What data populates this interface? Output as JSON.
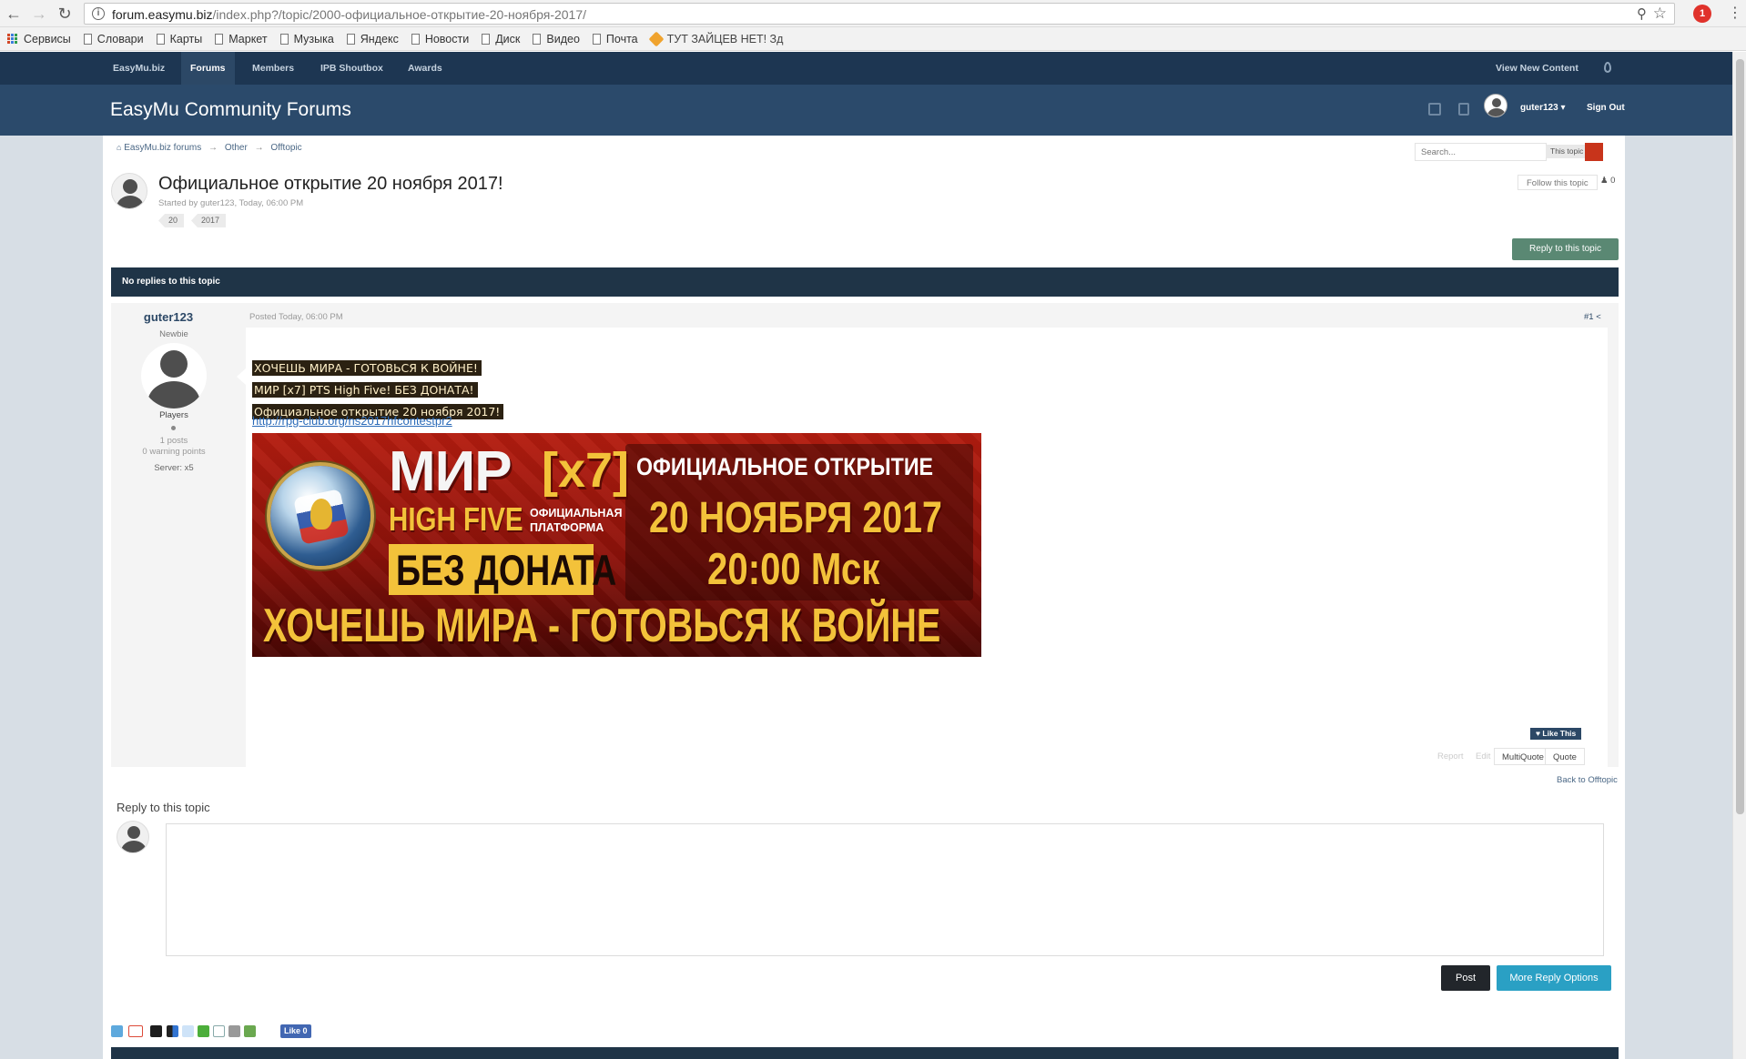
{
  "browser": {
    "url_domain": "forum.easymu.biz",
    "url_path": "/index.php?/topic/2000-официальное-открытие-20-ноября-2017/",
    "ext_badge": "1",
    "bookmarks": [
      {
        "label": "Сервисы",
        "icon": "apps-icon"
      },
      {
        "label": "Словари",
        "icon": "page-icon"
      },
      {
        "label": "Карты",
        "icon": "page-icon"
      },
      {
        "label": "Маркет",
        "icon": "page-icon"
      },
      {
        "label": "Музыка",
        "icon": "page-icon"
      },
      {
        "label": "Яндекс",
        "icon": "page-icon"
      },
      {
        "label": "Новости",
        "icon": "page-icon"
      },
      {
        "label": "Диск",
        "icon": "page-icon"
      },
      {
        "label": "Видео",
        "icon": "page-icon"
      },
      {
        "label": "Почта",
        "icon": "page-icon"
      },
      {
        "label": "ТУТ ЗАЙЦЕВ НЕТ! Зд",
        "icon": "tag-icon"
      }
    ]
  },
  "nav": {
    "items": [
      "EasyMu.biz",
      "Forums",
      "Members",
      "IPB Shoutbox",
      "Awards"
    ],
    "active": "Forums",
    "view_new": "View New Content"
  },
  "header": {
    "title": "EasyMu Community Forums",
    "username": "guter123 ▾",
    "sign_out": "Sign Out"
  },
  "breadcrumb": {
    "home": "EasyMu.biz forums",
    "level1": "Other",
    "level2": "Offtopic",
    "sep": "→"
  },
  "search": {
    "placeholder": "Search...",
    "scope": "This topic"
  },
  "topic": {
    "title": "Официальное открытие 20 ноября 2017!",
    "meta": "Started by guter123, Today, 06:00 PM",
    "tags": [
      "20",
      "2017"
    ],
    "follow": "Follow this topic",
    "follow_count": "0",
    "reply_button": "Reply to this topic",
    "no_replies": "No replies to this topic"
  },
  "post": {
    "author": "guter123",
    "rank": "Newbie",
    "group": "Players",
    "posts": "1 posts",
    "warnings": "0 warning points",
    "server": "Server: x5",
    "date": "Posted Today, 06:00 PM",
    "number": "#1",
    "lines": [
      "ХОЧЕШЬ МИРА - ГОТОВЬСЯ К ВОЙНЕ!",
      "МИР [x7] PTS High Five! БЕЗ ДОНАТА!",
      "Официальное открытие 20 ноября 2017!"
    ],
    "link": "http://rpg-club.org/ns2017hfcontestpr2",
    "banner": {
      "mir": "МИР",
      "x7": "[x7]",
      "high_five": "HIGH FIVE",
      "platform_line1": "ОФИЦИАЛЬНАЯ",
      "platform_line2": "ПЛАТФОРМА",
      "no_donate": "БЕЗ ДОНАТА",
      "official_open": "ОФИЦИАЛЬНОЕ ОТКРЫТИЕ",
      "date": "20 НОЯБРЯ 2017",
      "time": "20:00 Мск",
      "slogan": "ХОЧЕШЬ МИРА - ГОТОВЬСЯ К ВОЙНЕ"
    },
    "like": "Like This",
    "controls": {
      "report": "Report",
      "edit": "Edit",
      "multiquote": "MultiQuote",
      "quote": "Quote"
    }
  },
  "back_link": "Back to Offtopic",
  "reply": {
    "heading": "Reply to this topic",
    "post": "Post",
    "more": "More Reply Options"
  },
  "share": {
    "fb_like": "Like 0",
    "icons": [
      "twitter-icon",
      "google-plus-icon",
      "digg-icon",
      "delicious-icon",
      "reddit-icon",
      "stumbleupon-icon",
      "email-icon",
      "print-icon",
      "download-icon"
    ]
  },
  "colors": {
    "nav_bg": "#1d3652",
    "header_bg": "#2b4a6b",
    "bar_bg": "#1f3447",
    "reply_green": "#5a8873",
    "more_blue": "#2aa0c4",
    "highlight_bg": "#2b2112"
  }
}
